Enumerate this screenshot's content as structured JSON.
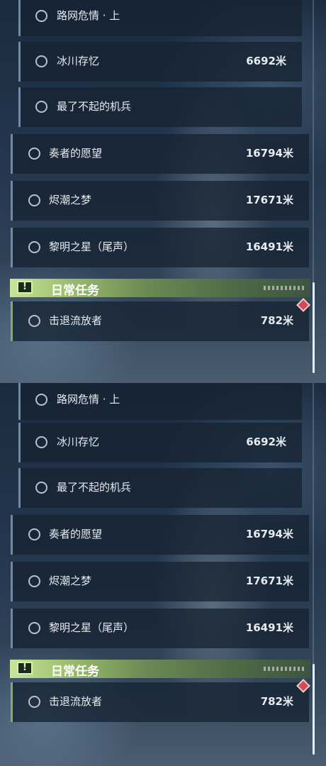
{
  "panels": [
    {
      "quests": [
        {
          "name": "路网危情 · 上",
          "distance": ""
        },
        {
          "name": "冰川存忆",
          "distance": "6692米"
        },
        {
          "name": "最了不起的机兵",
          "distance": ""
        },
        {
          "name": "奏者的愿望",
          "distance": "16794米"
        },
        {
          "name": "烬潮之梦",
          "distance": "17671米"
        },
        {
          "name": "黎明之星（尾声）",
          "distance": "16491米"
        }
      ],
      "daily_header": {
        "icon": "exclamation-icon",
        "title": "日常任务"
      },
      "daily_quests": [
        {
          "name": "击退流放者",
          "distance": "782米"
        }
      ]
    },
    {
      "quests": [
        {
          "name": "路网危情 · 上",
          "distance": ""
        },
        {
          "name": "冰川存忆",
          "distance": "6692米"
        },
        {
          "name": "最了不起的机兵",
          "distance": ""
        },
        {
          "name": "奏者的愿望",
          "distance": "16794米"
        },
        {
          "name": "烬潮之梦",
          "distance": "17671米"
        },
        {
          "name": "黎明之星（尾声）",
          "distance": "16491米"
        }
      ],
      "daily_header": {
        "icon": "exclamation-icon",
        "title": "日常任务"
      },
      "daily_quests": [
        {
          "name": "击退流放者",
          "distance": "782米"
        }
      ]
    }
  ],
  "colors": {
    "row_bg": "#162232",
    "row_accent": "#6f8aa1",
    "daily_accent": "#8ca86a",
    "daily_header": "#c9e59a",
    "marker": "#d24a55"
  }
}
